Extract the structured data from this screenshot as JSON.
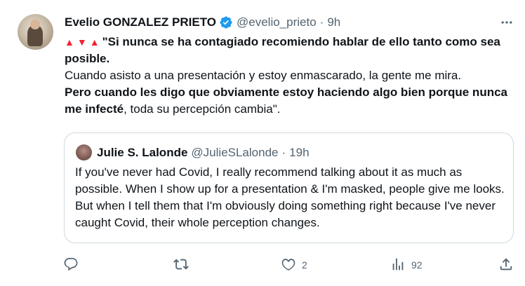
{
  "tweet": {
    "author_name": "Evelio GONZALEZ PRIETO",
    "author_handle": "@evelio_prieto",
    "separator": "·",
    "time": "9h",
    "triangles": "▲▼▲",
    "line1_bold": "\"Si nunca se ha contagiado recomiendo hablar de ello tanto como sea posible.",
    "line2": "Cuando asisto a una presentación y estoy enmascarado, la gente me mira.",
    "line3_bold": "Pero cuando les digo que obviamente estoy haciendo algo bien porque nunca me infecté",
    "line3_rest": ", toda su percepción cambia\".",
    "colors": {
      "verified": "#1d9bf0",
      "triangle": "#f4212e",
      "muted": "#536471"
    }
  },
  "quote": {
    "author_name": "Julie S. Lalonde",
    "author_handle": "@JulieSLalonde",
    "separator": "·",
    "time": "19h",
    "text": "If you've never had Covid, I really recommend talking about it as much as possible. When I show up for a presentation & I'm masked, people give me looks. But when I tell them that I'm obviously doing something right because I've never caught Covid, their whole perception changes."
  },
  "actions": {
    "reply_icon": "reply-icon",
    "retweet_icon": "retweet-icon",
    "like_icon": "like-icon",
    "like_count": "2",
    "views_icon": "views-icon",
    "views_count": "92",
    "share_icon": "share-icon"
  }
}
